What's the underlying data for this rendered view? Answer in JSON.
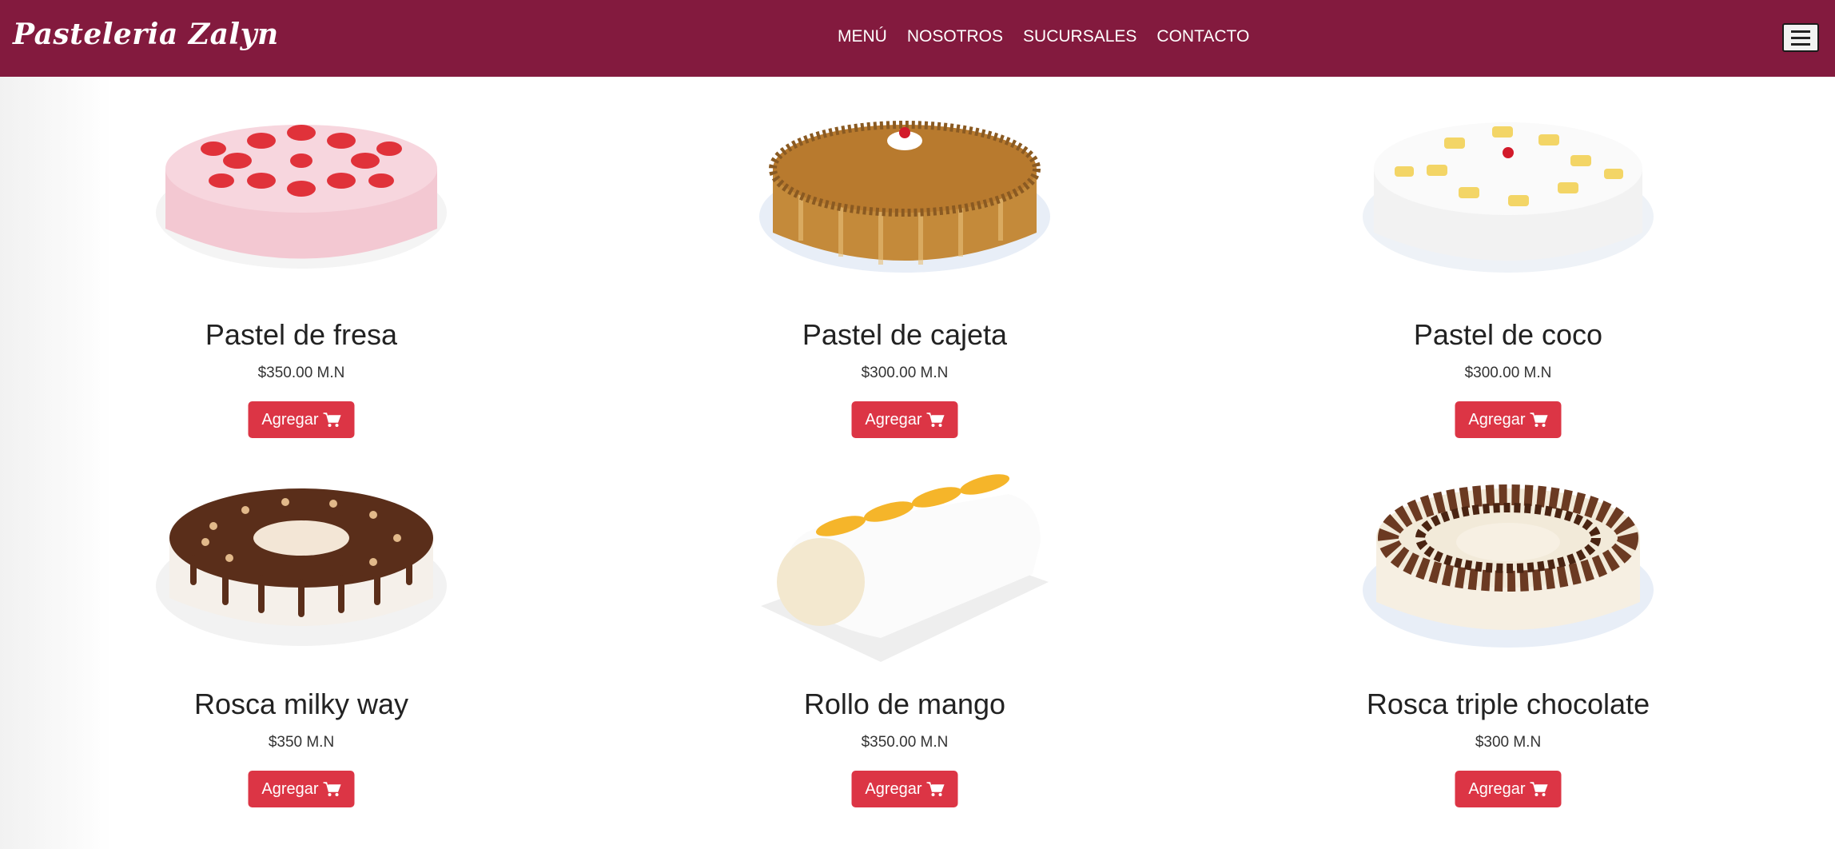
{
  "brand": {
    "name": "Pasteleria Zalyn"
  },
  "nav": {
    "links": [
      "MENÚ",
      "NOSOTROS",
      "SUCURSALES",
      "CONTACTO"
    ]
  },
  "colors": {
    "navbar": "#831a3e",
    "button": "#dc3545",
    "text": "#222222"
  },
  "products": [
    {
      "title": "Pastel de fresa",
      "price": "$350.00 M.N",
      "button": "Agregar",
      "icon": "cart-icon"
    },
    {
      "title": "Pastel de cajeta",
      "price": "$300.00 M.N",
      "button": "Agregar",
      "icon": "cart-icon"
    },
    {
      "title": "Pastel de coco",
      "price": "$300.00 M.N",
      "button": "Agregar",
      "icon": "cart-icon"
    },
    {
      "title": "Rosca milky way",
      "price": "$350 M.N",
      "button": "Agregar",
      "icon": "cart-icon"
    },
    {
      "title": "Rollo de mango",
      "price": "$350.00 M.N",
      "button": "Agregar",
      "icon": "cart-icon"
    },
    {
      "title": "Rosca triple chocolate",
      "price": "$300 M.N",
      "button": "Agregar",
      "icon": "cart-icon"
    }
  ]
}
